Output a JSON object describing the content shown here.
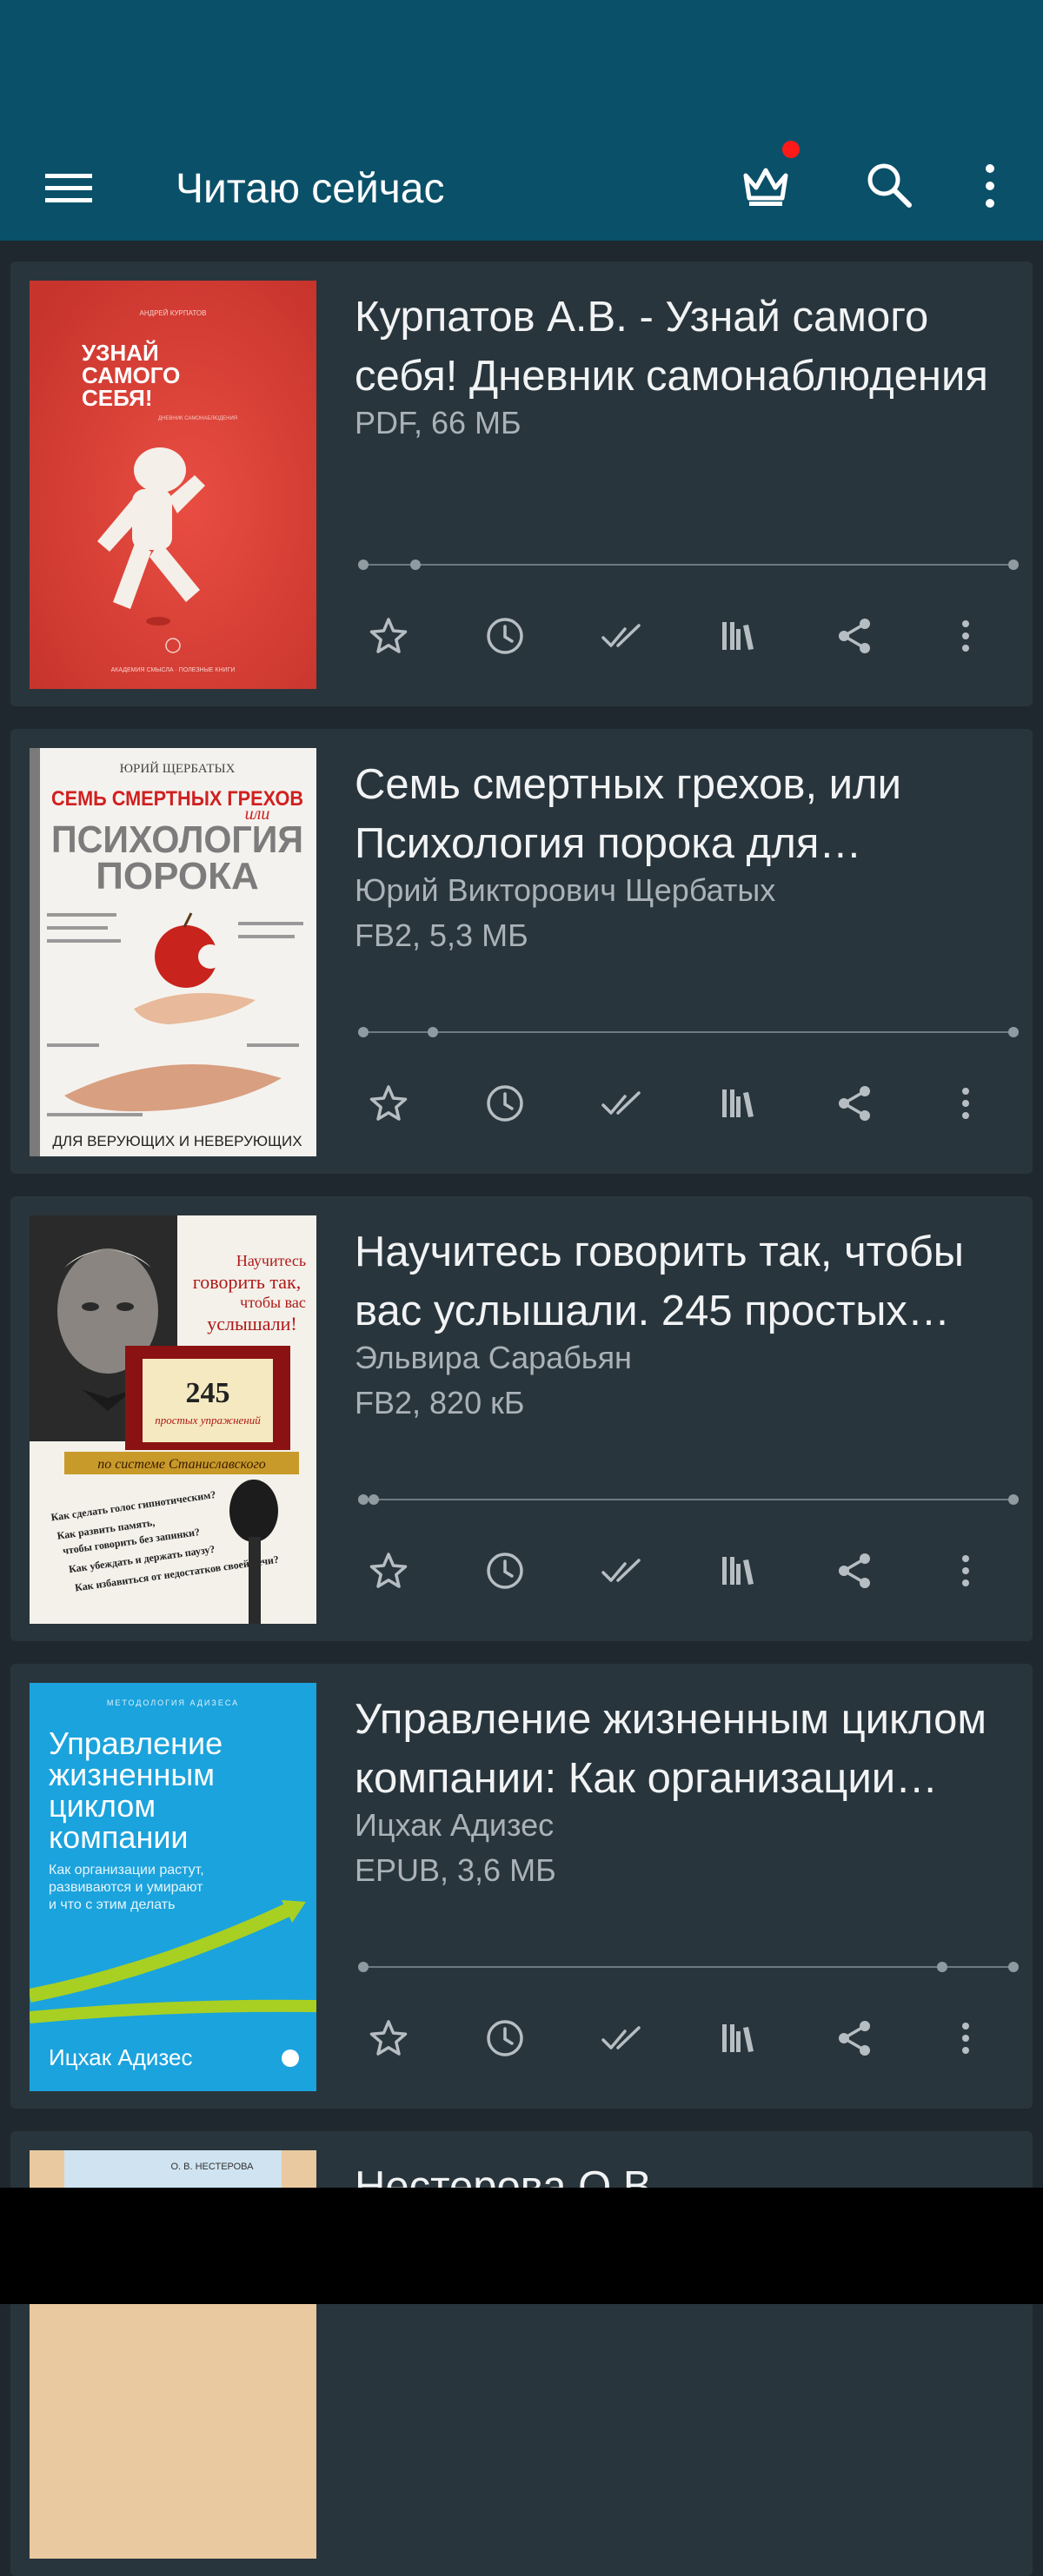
{
  "app_bar": {
    "title": "Читаю сейчас",
    "icons": [
      "menu-icon",
      "crown-icon",
      "search-icon",
      "more-vert-icon"
    ],
    "notification_dot_color": "#ff1a1a"
  },
  "colors": {
    "app_bar": "#0a5069",
    "background": "#1f282e",
    "card": "#29353c"
  },
  "books": [
    {
      "title": "Курпатов А.В. - Узнай самого себя! Дневник самонаблюдения",
      "meta": [
        "PDF, 66 МБ"
      ],
      "progress_markers": [
        0,
        0.08
      ],
      "cover": {
        "top": "АНДРЕЙ КУРПАТОВ",
        "lines": [
          "УЗНАЙ",
          "САМОГО",
          "СЕБЯ!"
        ],
        "sub": "ДНЕВНИК САМОНАБЛЮДЕНИЯ",
        "bottom": "АКАДЕМИЯ СМЫСЛА · ПОЛЕЗНЫЕ КНИГИ"
      }
    },
    {
      "title": "Семь смертных грехов, или Психология порока для верующих и неверующих",
      "meta": [
        "Юрий Викторович Щербатых",
        "FB2, 5,3 МБ"
      ],
      "progress_markers": [
        0,
        0.11
      ],
      "cover": {
        "top": "ЮРИЙ ЩЕРБАТЫХ",
        "lines": [
          "СЕМЬ СМЕРТНЫХ ГРЕХОВ",
          "или",
          "ПСИХОЛОГИЯ",
          "ПОРОКА"
        ],
        "bottom": "ДЛЯ ВЕРУЮЩИХ И НЕВЕРУЮЩИХ"
      }
    },
    {
      "title": "Научитесь говорить так, чтобы вас услышали. 245 простых упражнений по системе Станиславского",
      "meta": [
        "Эльвира Сарабьян",
        "FB2, 820 кБ"
      ],
      "progress_markers": [
        0,
        0.02
      ],
      "cover": {
        "lines": [
          "Научитесь",
          "говорить так,",
          "чтобы вас",
          "услышали!"
        ],
        "number": "245",
        "sub": "простых упражнений",
        "band": "по системе Станиславского",
        "notes": [
          "Как сделать голос гипнотическим?",
          "Как развить память,",
          "чтобы говорить без запинки?",
          "Как убеждать и держать паузу?",
          "Как избавиться от недостатков своей речи?"
        ]
      }
    },
    {
      "title": "Управление жизненным циклом компании: Как организации растут, развиваются и умирают",
      "meta": [
        "Ицхак Адизес",
        "EPUB, 3,6 МБ"
      ],
      "progress_markers": [
        0,
        0.89
      ],
      "cover": {
        "top": "МЕТОДОЛОГИЯ АДИЗЕСА",
        "lines": [
          "Управление",
          "жизненным",
          "циклом",
          "компании"
        ],
        "sub": [
          "Как организации растут,",
          "развиваются и умирают",
          "и что с этим делать"
        ],
        "author": "Ицхак Адизес"
      }
    },
    {
      "title": "Нестерова О.В. -",
      "meta": [],
      "cover": {
        "top": "О. В. НЕСТЕРОВА"
      }
    }
  ]
}
